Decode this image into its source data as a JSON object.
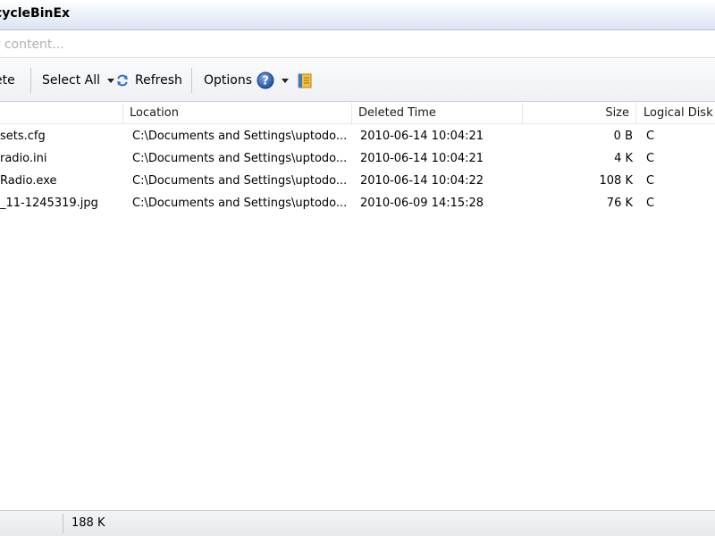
{
  "window": {
    "title": "cycleBinEx"
  },
  "search": {
    "placeholder": "er content..."
  },
  "toolbar": {
    "delete_label": "ete",
    "select_all_label": "Select All",
    "refresh_label": "Refresh",
    "options_label": "Options",
    "help_icon": "question-circle-icon",
    "extra_icon": "notebook-icon"
  },
  "columns": {
    "name": "",
    "location": "Location",
    "deleted_time": "Deleted Time",
    "size": "Size",
    "logical_disk": "Logical Disk"
  },
  "rows": [
    {
      "name": "sets.cfg",
      "location": "C:\\Documents and Settings\\uptodo...",
      "deleted_time": "2010-06-14 10:04:21",
      "size": "0 B",
      "disk": "C"
    },
    {
      "name": "radio.ini",
      "location": "C:\\Documents and Settings\\uptodo...",
      "deleted_time": "2010-06-14 10:04:21",
      "size": "4 K",
      "disk": "C"
    },
    {
      "name": "Radio.exe",
      "location": "C:\\Documents and Settings\\uptodo...",
      "deleted_time": "2010-06-14 10:04:22",
      "size": "108 K",
      "disk": "C"
    },
    {
      "name": "_11-1245319.jpg",
      "location": "C:\\Documents and Settings\\uptodo...",
      "deleted_time": "2010-06-09 14:15:28",
      "size": "76 K",
      "disk": "C"
    }
  ],
  "status": {
    "total_size": "188 K"
  },
  "colors": {
    "help_blue": "#2d5fb3",
    "refresh_blue": "#2f6fc7"
  }
}
